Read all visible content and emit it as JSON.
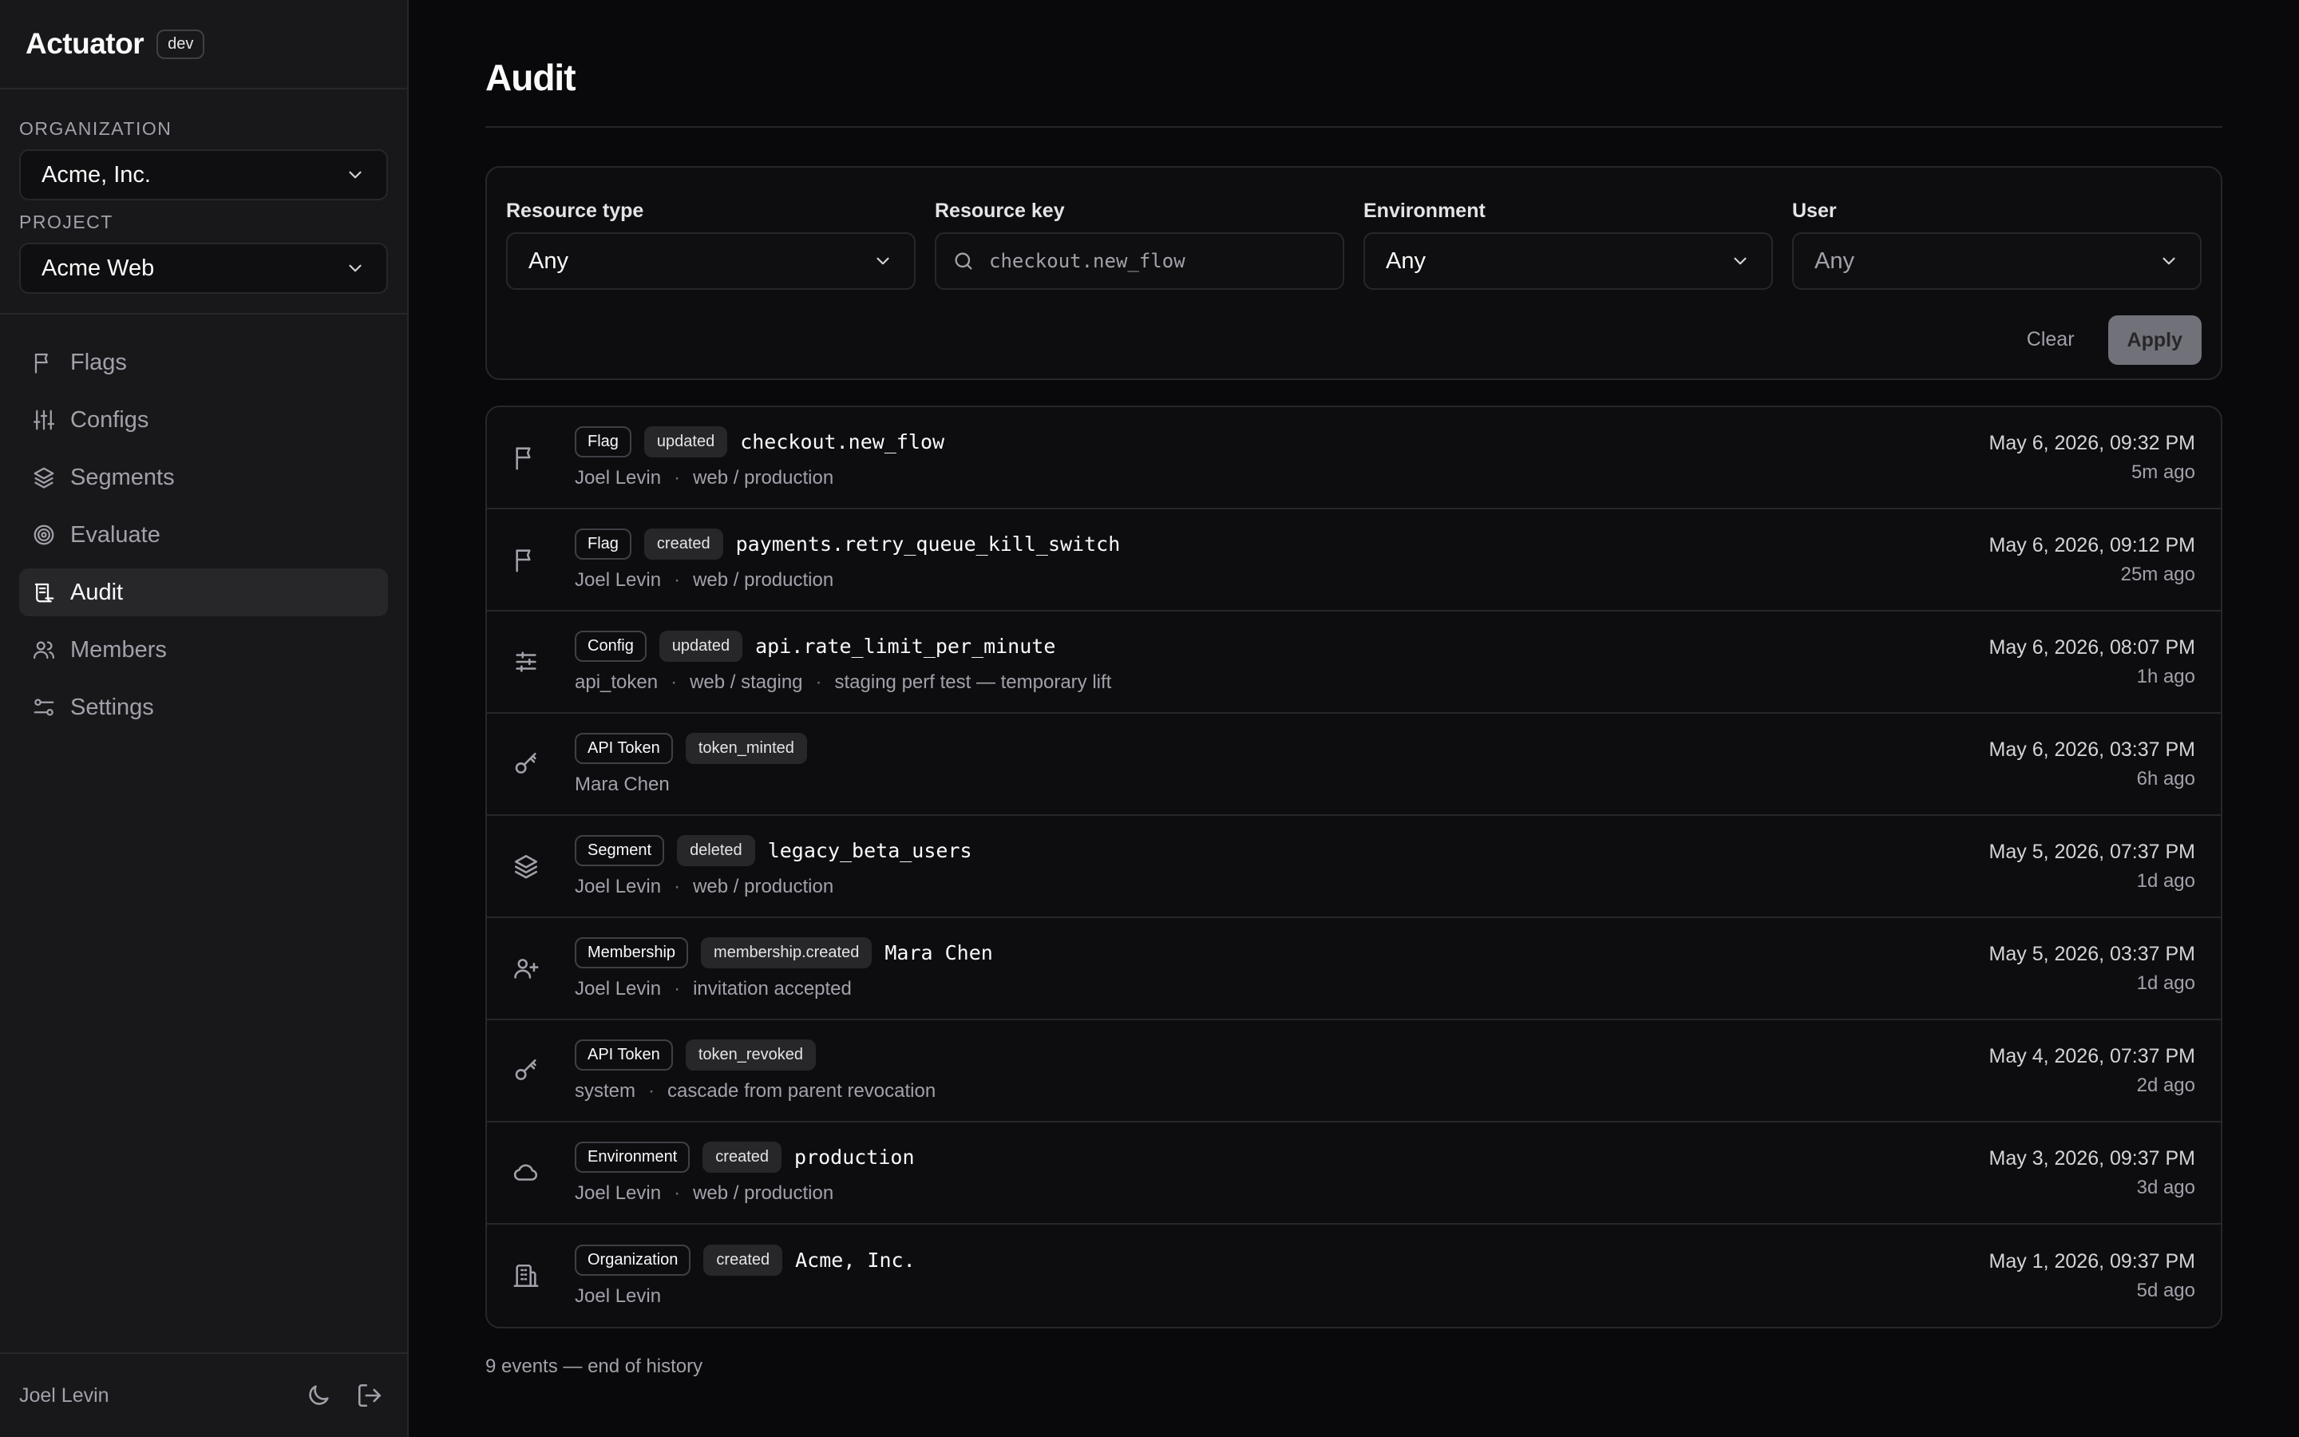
{
  "app": {
    "name": "Actuator",
    "env_badge": "dev"
  },
  "sidebar": {
    "organization_label": "ORGANIZATION",
    "organization_value": "Acme, Inc.",
    "project_label": "PROJECT",
    "project_value": "Acme Web",
    "items": [
      {
        "label": "Flags",
        "icon": "flag-icon"
      },
      {
        "label": "Configs",
        "icon": "sliders-icon"
      },
      {
        "label": "Segments",
        "icon": "layers-icon"
      },
      {
        "label": "Evaluate",
        "icon": "target-icon"
      },
      {
        "label": "Audit",
        "icon": "scroll-icon",
        "active": true
      },
      {
        "label": "Members",
        "icon": "users-icon"
      },
      {
        "label": "Settings",
        "icon": "settings-icon"
      }
    ],
    "footer_user": "Joel Levin"
  },
  "page": {
    "title": "Audit"
  },
  "filters": {
    "resource_type": {
      "label": "Resource type",
      "value": "Any"
    },
    "resource_key": {
      "label": "Resource key",
      "placeholder": "checkout.new_flow"
    },
    "environment": {
      "label": "Environment",
      "value": "Any"
    },
    "user": {
      "label": "User",
      "value": "Any"
    },
    "clear_label": "Clear",
    "apply_label": "Apply"
  },
  "events": [
    {
      "icon": "flag-icon",
      "type": "Flag",
      "action": "updated",
      "key": "checkout.new_flow",
      "meta": [
        "Joel Levin",
        "web / production"
      ],
      "date": "May 6, 2026, 09:32 PM",
      "ago": "5m ago"
    },
    {
      "icon": "flag-icon",
      "type": "Flag",
      "action": "created",
      "key": "payments.retry_queue_kill_switch",
      "meta": [
        "Joel Levin",
        "web / production"
      ],
      "date": "May 6, 2026, 09:12 PM",
      "ago": "25m ago"
    },
    {
      "icon": "sliders-icon",
      "type": "Config",
      "action": "updated",
      "key": "api.rate_limit_per_minute",
      "meta": [
        "api_token",
        "web / staging",
        "staging perf test — temporary lift"
      ],
      "date": "May 6, 2026, 08:07 PM",
      "ago": "1h ago"
    },
    {
      "icon": "key-icon",
      "type": "API Token",
      "action": "token_minted",
      "key": "",
      "meta": [
        "Mara Chen"
      ],
      "date": "May 6, 2026, 03:37 PM",
      "ago": "6h ago"
    },
    {
      "icon": "layers-icon",
      "type": "Segment",
      "action": "deleted",
      "key": "legacy_beta_users",
      "meta": [
        "Joel Levin",
        "web / production"
      ],
      "date": "May 5, 2026, 07:37 PM",
      "ago": "1d ago"
    },
    {
      "icon": "user-plus-icon",
      "type": "Membership",
      "action": "membership.created",
      "key": "Mara Chen",
      "meta": [
        "Joel Levin",
        "invitation accepted"
      ],
      "date": "May 5, 2026, 03:37 PM",
      "ago": "1d ago"
    },
    {
      "icon": "key-icon",
      "type": "API Token",
      "action": "token_revoked",
      "key": "",
      "meta": [
        "system",
        "cascade from parent revocation"
      ],
      "date": "May 4, 2026, 07:37 PM",
      "ago": "2d ago"
    },
    {
      "icon": "cloud-icon",
      "type": "Environment",
      "action": "created",
      "key": "production",
      "meta": [
        "Joel Levin",
        "web / production"
      ],
      "date": "May 3, 2026, 09:37 PM",
      "ago": "3d ago"
    },
    {
      "icon": "building-icon",
      "type": "Organization",
      "action": "created",
      "key": "Acme, Inc.",
      "meta": [
        "Joel Levin"
      ],
      "date": "May 1, 2026, 09:37 PM",
      "ago": "5d ago"
    }
  ],
  "summary": "9 events — end of history"
}
